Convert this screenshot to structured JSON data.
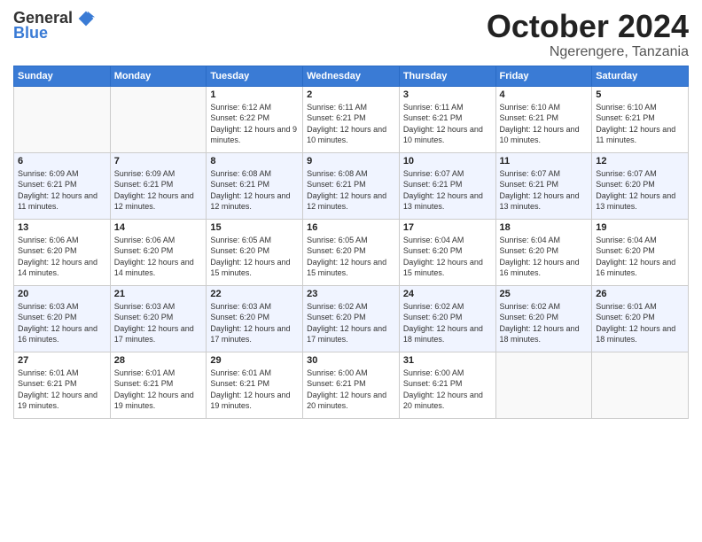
{
  "logo": {
    "general": "General",
    "blue": "Blue"
  },
  "title": "October 2024",
  "location": "Ngerengere, Tanzania",
  "days_header": [
    "Sunday",
    "Monday",
    "Tuesday",
    "Wednesday",
    "Thursday",
    "Friday",
    "Saturday"
  ],
  "weeks": [
    [
      {
        "day": "",
        "sunrise": "",
        "sunset": "",
        "daylight": ""
      },
      {
        "day": "",
        "sunrise": "",
        "sunset": "",
        "daylight": ""
      },
      {
        "day": "1",
        "sunrise": "Sunrise: 6:12 AM",
        "sunset": "Sunset: 6:22 PM",
        "daylight": "Daylight: 12 hours and 9 minutes."
      },
      {
        "day": "2",
        "sunrise": "Sunrise: 6:11 AM",
        "sunset": "Sunset: 6:21 PM",
        "daylight": "Daylight: 12 hours and 10 minutes."
      },
      {
        "day": "3",
        "sunrise": "Sunrise: 6:11 AM",
        "sunset": "Sunset: 6:21 PM",
        "daylight": "Daylight: 12 hours and 10 minutes."
      },
      {
        "day": "4",
        "sunrise": "Sunrise: 6:10 AM",
        "sunset": "Sunset: 6:21 PM",
        "daylight": "Daylight: 12 hours and 10 minutes."
      },
      {
        "day": "5",
        "sunrise": "Sunrise: 6:10 AM",
        "sunset": "Sunset: 6:21 PM",
        "daylight": "Daylight: 12 hours and 11 minutes."
      }
    ],
    [
      {
        "day": "6",
        "sunrise": "Sunrise: 6:09 AM",
        "sunset": "Sunset: 6:21 PM",
        "daylight": "Daylight: 12 hours and 11 minutes."
      },
      {
        "day": "7",
        "sunrise": "Sunrise: 6:09 AM",
        "sunset": "Sunset: 6:21 PM",
        "daylight": "Daylight: 12 hours and 12 minutes."
      },
      {
        "day": "8",
        "sunrise": "Sunrise: 6:08 AM",
        "sunset": "Sunset: 6:21 PM",
        "daylight": "Daylight: 12 hours and 12 minutes."
      },
      {
        "day": "9",
        "sunrise": "Sunrise: 6:08 AM",
        "sunset": "Sunset: 6:21 PM",
        "daylight": "Daylight: 12 hours and 12 minutes."
      },
      {
        "day": "10",
        "sunrise": "Sunrise: 6:07 AM",
        "sunset": "Sunset: 6:21 PM",
        "daylight": "Daylight: 12 hours and 13 minutes."
      },
      {
        "day": "11",
        "sunrise": "Sunrise: 6:07 AM",
        "sunset": "Sunset: 6:21 PM",
        "daylight": "Daylight: 12 hours and 13 minutes."
      },
      {
        "day": "12",
        "sunrise": "Sunrise: 6:07 AM",
        "sunset": "Sunset: 6:20 PM",
        "daylight": "Daylight: 12 hours and 13 minutes."
      }
    ],
    [
      {
        "day": "13",
        "sunrise": "Sunrise: 6:06 AM",
        "sunset": "Sunset: 6:20 PM",
        "daylight": "Daylight: 12 hours and 14 minutes."
      },
      {
        "day": "14",
        "sunrise": "Sunrise: 6:06 AM",
        "sunset": "Sunset: 6:20 PM",
        "daylight": "Daylight: 12 hours and 14 minutes."
      },
      {
        "day": "15",
        "sunrise": "Sunrise: 6:05 AM",
        "sunset": "Sunset: 6:20 PM",
        "daylight": "Daylight: 12 hours and 15 minutes."
      },
      {
        "day": "16",
        "sunrise": "Sunrise: 6:05 AM",
        "sunset": "Sunset: 6:20 PM",
        "daylight": "Daylight: 12 hours and 15 minutes."
      },
      {
        "day": "17",
        "sunrise": "Sunrise: 6:04 AM",
        "sunset": "Sunset: 6:20 PM",
        "daylight": "Daylight: 12 hours and 15 minutes."
      },
      {
        "day": "18",
        "sunrise": "Sunrise: 6:04 AM",
        "sunset": "Sunset: 6:20 PM",
        "daylight": "Daylight: 12 hours and 16 minutes."
      },
      {
        "day": "19",
        "sunrise": "Sunrise: 6:04 AM",
        "sunset": "Sunset: 6:20 PM",
        "daylight": "Daylight: 12 hours and 16 minutes."
      }
    ],
    [
      {
        "day": "20",
        "sunrise": "Sunrise: 6:03 AM",
        "sunset": "Sunset: 6:20 PM",
        "daylight": "Daylight: 12 hours and 16 minutes."
      },
      {
        "day": "21",
        "sunrise": "Sunrise: 6:03 AM",
        "sunset": "Sunset: 6:20 PM",
        "daylight": "Daylight: 12 hours and 17 minutes."
      },
      {
        "day": "22",
        "sunrise": "Sunrise: 6:03 AM",
        "sunset": "Sunset: 6:20 PM",
        "daylight": "Daylight: 12 hours and 17 minutes."
      },
      {
        "day": "23",
        "sunrise": "Sunrise: 6:02 AM",
        "sunset": "Sunset: 6:20 PM",
        "daylight": "Daylight: 12 hours and 17 minutes."
      },
      {
        "day": "24",
        "sunrise": "Sunrise: 6:02 AM",
        "sunset": "Sunset: 6:20 PM",
        "daylight": "Daylight: 12 hours and 18 minutes."
      },
      {
        "day": "25",
        "sunrise": "Sunrise: 6:02 AM",
        "sunset": "Sunset: 6:20 PM",
        "daylight": "Daylight: 12 hours and 18 minutes."
      },
      {
        "day": "26",
        "sunrise": "Sunrise: 6:01 AM",
        "sunset": "Sunset: 6:20 PM",
        "daylight": "Daylight: 12 hours and 18 minutes."
      }
    ],
    [
      {
        "day": "27",
        "sunrise": "Sunrise: 6:01 AM",
        "sunset": "Sunset: 6:21 PM",
        "daylight": "Daylight: 12 hours and 19 minutes."
      },
      {
        "day": "28",
        "sunrise": "Sunrise: 6:01 AM",
        "sunset": "Sunset: 6:21 PM",
        "daylight": "Daylight: 12 hours and 19 minutes."
      },
      {
        "day": "29",
        "sunrise": "Sunrise: 6:01 AM",
        "sunset": "Sunset: 6:21 PM",
        "daylight": "Daylight: 12 hours and 19 minutes."
      },
      {
        "day": "30",
        "sunrise": "Sunrise: 6:00 AM",
        "sunset": "Sunset: 6:21 PM",
        "daylight": "Daylight: 12 hours and 20 minutes."
      },
      {
        "day": "31",
        "sunrise": "Sunrise: 6:00 AM",
        "sunset": "Sunset: 6:21 PM",
        "daylight": "Daylight: 12 hours and 20 minutes."
      },
      {
        "day": "",
        "sunrise": "",
        "sunset": "",
        "daylight": ""
      },
      {
        "day": "",
        "sunrise": "",
        "sunset": "",
        "daylight": ""
      }
    ]
  ]
}
